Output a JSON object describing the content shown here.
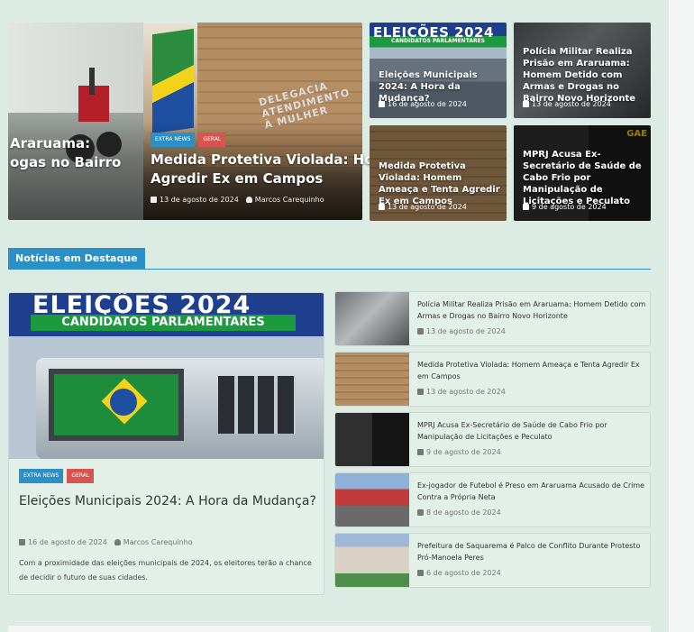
{
  "hero": {
    "prev_title_line1": "Araruama:",
    "prev_title_line2": "ogas no Bairro",
    "categories": [
      "EXTRA NEWS",
      "GERAL"
    ],
    "title_line1": "Medida Protetiva Violada: Home",
    "title_line2": "Agredir Ex em Campos",
    "date": "13 de agosto de 2024",
    "author": "Marcos Carequinho",
    "building_text": "DELEGACIA\nATENDIMENTO\nÀ MULHER"
  },
  "grid": [
    {
      "title": "Eleições Municipais 2024: A Hora da Mudança?",
      "date": "16 de agosto de 2024",
      "image_text": "ELEIÇÕES 2024",
      "image_subtext": "CANDIDATOS PARLAMENTARES"
    },
    {
      "title": "Polícia Militar Realiza Prisão em Araruama: Homem Detido com Armas e Drogas no Bairro Novo Horizonte",
      "date": "13 de agosto de 2024"
    },
    {
      "title": "Medida Protetiva Violada: Homem Ameaça e Tenta Agredir Ex em Campos",
      "date": "13 de agosto de 2024"
    },
    {
      "title": "MPRJ Acusa Ex-Secretário de Saúde de Cabo Frio por Manipulação de Licitações e Peculato",
      "date": "9 de agosto de 2024",
      "image_text": "GAE"
    }
  ],
  "section": {
    "title": "Notícias em Destaque"
  },
  "featured": {
    "image_text": "ELEIÇÕES 2024",
    "image_subtext": "CANDIDATOS PARLAMENTARES",
    "categories": [
      "EXTRA NEWS",
      "GERAL"
    ],
    "title": "Eleições Municipais 2024: A Hora da Mudança?",
    "date": "16 de agosto de 2024",
    "author": "Marcos Carequinho",
    "excerpt": "Com a proximidade das eleições municipais de 2024, os eleitores terão a chance de decidir o futuro de suas cidades."
  },
  "list": [
    {
      "title": "Polícia Militar Realiza Prisão em Araruama: Homem Detido com Armas e Drogas no Bairro Novo Horizonte",
      "date": "13 de agosto de 2024"
    },
    {
      "title": "Medida Protetiva Violada: Homem Ameaça e Tenta Agredir Ex em Campos",
      "date": "13 de agosto de 2024"
    },
    {
      "title": "MPRJ Acusa Ex-Secretário de Saúde de Cabo Frio por Manipulação de Licitações e Peculato",
      "date": "9 de agosto de 2024"
    },
    {
      "title": "Ex-jogador de Futebol é Preso em Araruama Acusado de Crime Contra a Própria Neta",
      "date": "8 de agosto de 2024"
    },
    {
      "title": "Prefeitura de Saquarema é Palco de Conflito Durante Protesto Pró-Manoela Peres",
      "date": "6 de agosto de 2024"
    }
  ],
  "colors": {
    "accent": "#2a90c8",
    "tag_red": "#d9534f",
    "page_bg": "#dcebe4"
  }
}
